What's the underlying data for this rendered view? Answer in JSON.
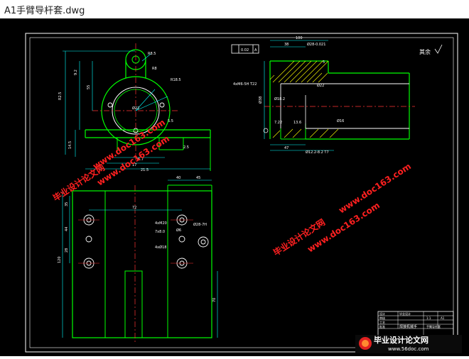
{
  "window": {
    "title": "A1手臂导杆套.dwg"
  },
  "drawing": {
    "surface_mark": "其余",
    "flatness_tol": "0.02",
    "flatness_datum": "A",
    "dims_top_view": [
      "R8.5",
      "R8",
      "R18.5",
      "Ø22",
      "R2.5",
      "5.5",
      "9.2",
      "55",
      "35",
      "52",
      "38",
      "14.5",
      "6.7",
      "12",
      "17",
      "21.5",
      "42",
      "2.5",
      "3.2"
    ],
    "dims_section": [
      "100",
      "38",
      "Ø28-0.021",
      "Ø38",
      "4xM6-5H T22",
      "Ø18.2",
      "Ø22",
      "5",
      "Ø16",
      "1.5",
      "7.22",
      "13.6",
      "Ø42",
      "47",
      "Ø12.2-8.2 T7"
    ],
    "dims_front_view": [
      "40",
      "45",
      "72",
      "35",
      "44",
      "28",
      "Ø28-7H",
      "4xM20",
      "7x8.0",
      "Ø6",
      "4xØ18",
      "120",
      "70"
    ],
    "title_block": {
      "name": "焊接机械手",
      "part": "手臂导杆套",
      "school": "毕业设计",
      "rows": [
        "设计",
        "审核",
        "工艺",
        "批准"
      ],
      "scale": "1:1",
      "sheet": "A1"
    }
  },
  "watermark": {
    "site": "www.doc163.com",
    "cn": "毕业设计论文网",
    "brand_cn": "毕业设计论文网",
    "brand_url": "www.56doc.com"
  },
  "colors": {
    "bg": "#000000",
    "outline": "#ffffff",
    "part": "#00ff00",
    "dim": "#00ffff",
    "center": "#ff3030",
    "hatch": "#ffff00",
    "wm": "#ff2020"
  }
}
